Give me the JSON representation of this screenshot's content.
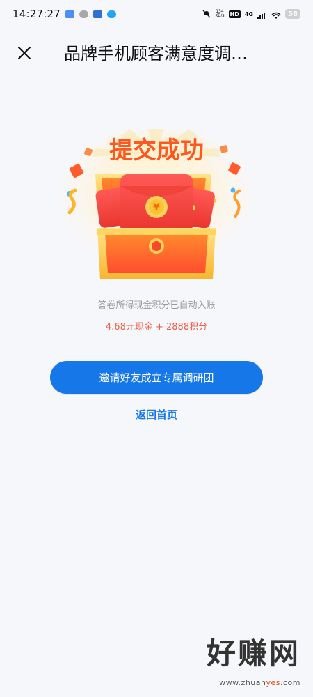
{
  "status_bar": {
    "time": "14:27:27",
    "network_speed_value": "134",
    "network_speed_unit": "KB/s",
    "hd_label": "HD",
    "network_type": "4G",
    "battery": "58"
  },
  "nav": {
    "title": "品牌手机顾客满意度调…"
  },
  "success": {
    "title": "提交成功",
    "info": "答卷所得现金积分已自动入账",
    "reward": "4.68元现金 + 2888积分"
  },
  "actions": {
    "invite_label": "邀请好友成立专属调研团",
    "back_label": "返回首页"
  },
  "watermark": {
    "main": "好赚网",
    "sub_prefix": "www.zhuan",
    "sub_accent": "yes",
    "sub_suffix": ".com"
  },
  "colors": {
    "primary": "#1677e8",
    "reward": "#f05d45",
    "title_orange": "#ff5722"
  }
}
